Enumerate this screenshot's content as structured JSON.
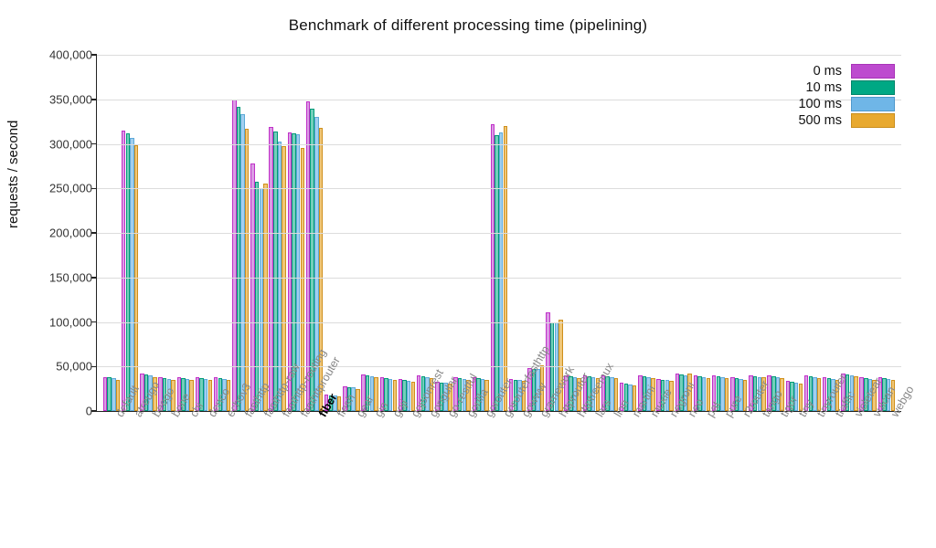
{
  "chart_data": {
    "type": "bar",
    "title": "Benchmark of different processing time (pipelining)",
    "ylabel": "requests / second",
    "ylim": [
      0,
      400000
    ],
    "yticks": [
      0,
      50000,
      100000,
      150000,
      200000,
      250000,
      300000,
      350000,
      400000
    ],
    "highlight_category": "fiber",
    "legend": {
      "position": "top-right"
    },
    "series_names": [
      "0 ms",
      "10 ms",
      "100 ms",
      "500 ms"
    ],
    "categories": [
      "default",
      "atreugo",
      "beego",
      "bone",
      "chi",
      "denco",
      "echov3",
      "fasthttp",
      "fasthttp-raw",
      "fasthttp-routing",
      "fasthttprouter",
      "fiber",
      "flesh",
      "gear",
      "gin",
      "goji",
      "gojsonrest",
      "gongular",
      "go-restful",
      "gorilla",
      "gorouter",
      "gorouterfasthttp",
      "gowww",
      "gramework",
      "httprouter",
      "httptreemux",
      "lars",
      "lion",
      "martini",
      "muxie",
      "negroni",
      "neo",
      "pat",
      "pure",
      "r2router",
      "tango",
      "tigor",
      "tiny",
      "tinyrouter",
      "traffic",
      "violetear",
      "vulcan",
      "webgo"
    ],
    "series": [
      {
        "name": "0 ms",
        "values": [
          38000,
          315000,
          42000,
          38000,
          38000,
          38000,
          38000,
          350000,
          278000,
          319000,
          313000,
          348000,
          18000,
          28000,
          41000,
          38000,
          36000,
          40000,
          33000,
          38000,
          38000,
          322000,
          36000,
          48000,
          111000,
          40000,
          40000,
          40000,
          32000,
          40000,
          36000,
          42000,
          40000,
          40000,
          38000,
          40000,
          40000,
          34000,
          40000,
          38000,
          42000,
          38000,
          38000
        ]
      },
      {
        "name": "10 ms",
        "values": [
          38000,
          312000,
          41000,
          37000,
          37000,
          37000,
          37000,
          342000,
          257000,
          314000,
          312000,
          340000,
          17000,
          27000,
          40000,
          37000,
          35000,
          39000,
          32000,
          37000,
          37000,
          310000,
          35000,
          47000,
          100000,
          39000,
          39000,
          39000,
          31000,
          39000,
          35000,
          41000,
          39000,
          39000,
          37000,
          39000,
          39000,
          33000,
          39000,
          37000,
          41000,
          37000,
          37000
        ]
      },
      {
        "name": "100 ms",
        "values": [
          37000,
          307000,
          40000,
          36000,
          36000,
          36000,
          36000,
          333000,
          250000,
          303000,
          311000,
          330000,
          17000,
          27000,
          39000,
          36000,
          34000,
          38000,
          32000,
          36000,
          36000,
          313000,
          35000,
          47000,
          100000,
          38000,
          38000,
          38000,
          30000,
          38000,
          35000,
          40000,
          38000,
          38000,
          36000,
          38000,
          38000,
          32000,
          38000,
          36000,
          40000,
          36000,
          36000
        ]
      },
      {
        "name": "500 ms",
        "values": [
          35000,
          298000,
          38000,
          35000,
          35000,
          35000,
          35000,
          317000,
          255000,
          297000,
          295000,
          318000,
          16000,
          25000,
          38000,
          35000,
          33000,
          37000,
          31000,
          35000,
          35000,
          320000,
          34000,
          51000,
          103000,
          37000,
          37000,
          37000,
          29000,
          37000,
          34000,
          42000,
          37000,
          37000,
          35000,
          38000,
          37000,
          31000,
          37000,
          35000,
          39000,
          35000,
          35000
        ]
      }
    ]
  }
}
